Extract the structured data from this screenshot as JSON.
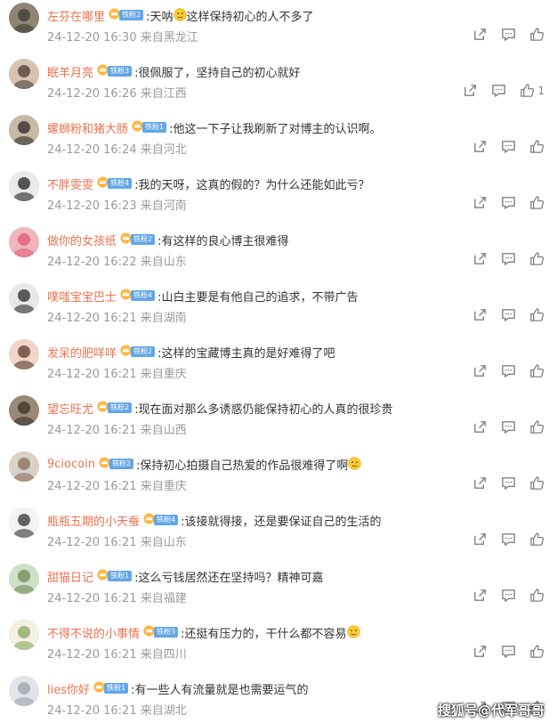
{
  "comments": [
    {
      "user": "左芬在哪里",
      "fan_level": "铁粉2",
      "text": ":天呐",
      "text_after_emoji": "这样保持初心的人不多了",
      "emoji_inline": true,
      "time": "24-12-20 16:30",
      "location": "来自黑龙江",
      "likes": ""
    },
    {
      "user": "眠羊月亮",
      "fan_level": "铁粉3",
      "text": ":很佩服了，坚持自己的初心就好",
      "text_after_emoji": "",
      "emoji_inline": false,
      "time": "24-12-20 16:26",
      "location": "来自江西",
      "likes": "1"
    },
    {
      "user": "螺蛳粉和猪大肠",
      "fan_level": "铁粉1",
      "text": ":他这一下子让我刷新了对博主的认识啊。",
      "text_after_emoji": "",
      "emoji_inline": false,
      "time": "24-12-20 16:24",
      "location": "来自河北",
      "likes": ""
    },
    {
      "user": "不胖雯雯",
      "fan_level": "铁粉4",
      "text": ":我的天呀，这真的假的？为什么还能如此亏？",
      "text_after_emoji": "",
      "emoji_inline": false,
      "time": "24-12-20 16:23",
      "location": "来自河南",
      "likes": ""
    },
    {
      "user": "做你的女孩纸",
      "fan_level": "铁粉2",
      "text": ":有这样的良心博主很难得",
      "text_after_emoji": "",
      "emoji_inline": false,
      "time": "24-12-20 16:22",
      "location": "来自山东",
      "likes": ""
    },
    {
      "user": "噗嗤宝宝巴士",
      "fan_level": "铁粉4",
      "text": ":山白主要是有他自己的追求，不带广告",
      "text_after_emoji": "",
      "emoji_inline": false,
      "time": "24-12-20 16:21",
      "location": "来自湖南",
      "likes": ""
    },
    {
      "user": "发呆的肥咩咩",
      "fan_level": "铁粉2",
      "text": ":这样的宝藏博主真的是好难得了吧",
      "text_after_emoji": "",
      "emoji_inline": false,
      "time": "24-12-20 16:21",
      "location": "来自重庆",
      "likes": ""
    },
    {
      "user": "望忘旺尤",
      "fan_level": "铁粉2",
      "text": ":现在面对那么多诱惑仍能保持初心的人真的很珍贵",
      "text_after_emoji": "",
      "emoji_inline": false,
      "time": "24-12-20 16:21",
      "location": "来自山西",
      "likes": ""
    },
    {
      "user": "9ciocoin",
      "fan_level": "铁粉2",
      "text": ":保持初心拍摄自己热爱的作品很难得了啊",
      "text_after_emoji": "",
      "emoji_inline": true,
      "time": "24-12-20 16:21",
      "location": "来自重庆",
      "likes": ""
    },
    {
      "user": "瓶瓶五期的小天蚕",
      "fan_level": "铁粉4",
      "text": ":该接就得接，还是要保证自己的生活的",
      "text_after_emoji": "",
      "emoji_inline": false,
      "time": "24-12-20 16:21",
      "location": "来自山东",
      "likes": ""
    },
    {
      "user": "甜猫日记",
      "fan_level": "铁粉1",
      "text": ":这么亏钱居然还在坚持吗？精神可嘉",
      "text_after_emoji": "",
      "emoji_inline": false,
      "time": "24-12-20 16:21",
      "location": "来自福建",
      "likes": ""
    },
    {
      "user": "不得不说的小事情",
      "fan_level": "铁粉3",
      "text": ":还挺有压力的，干什么都不容易",
      "text_after_emoji": "",
      "emoji_inline": true,
      "time": "24-12-20 16:21",
      "location": "来自四川",
      "likes": ""
    },
    {
      "user": "lies你好",
      "fan_level": "铁粉1",
      "text": ":有一些人有流量就是也需要运气的",
      "text_after_emoji": "",
      "emoji_inline": false,
      "time": "24-12-20 16:21",
      "location": "来自湖北",
      "likes": ""
    }
  ],
  "watermark": "搜狐号@代军哥哥",
  "colors": {
    "username": "#eb7350",
    "text": "#333333",
    "meta": "#9a9a9a",
    "badge": "#62a6e8"
  },
  "icons": {
    "forward": "share-icon",
    "comment": "comment-icon",
    "like": "thumbs-up-icon",
    "fan": "crown-icon",
    "emoji": "emoji-face-icon"
  }
}
